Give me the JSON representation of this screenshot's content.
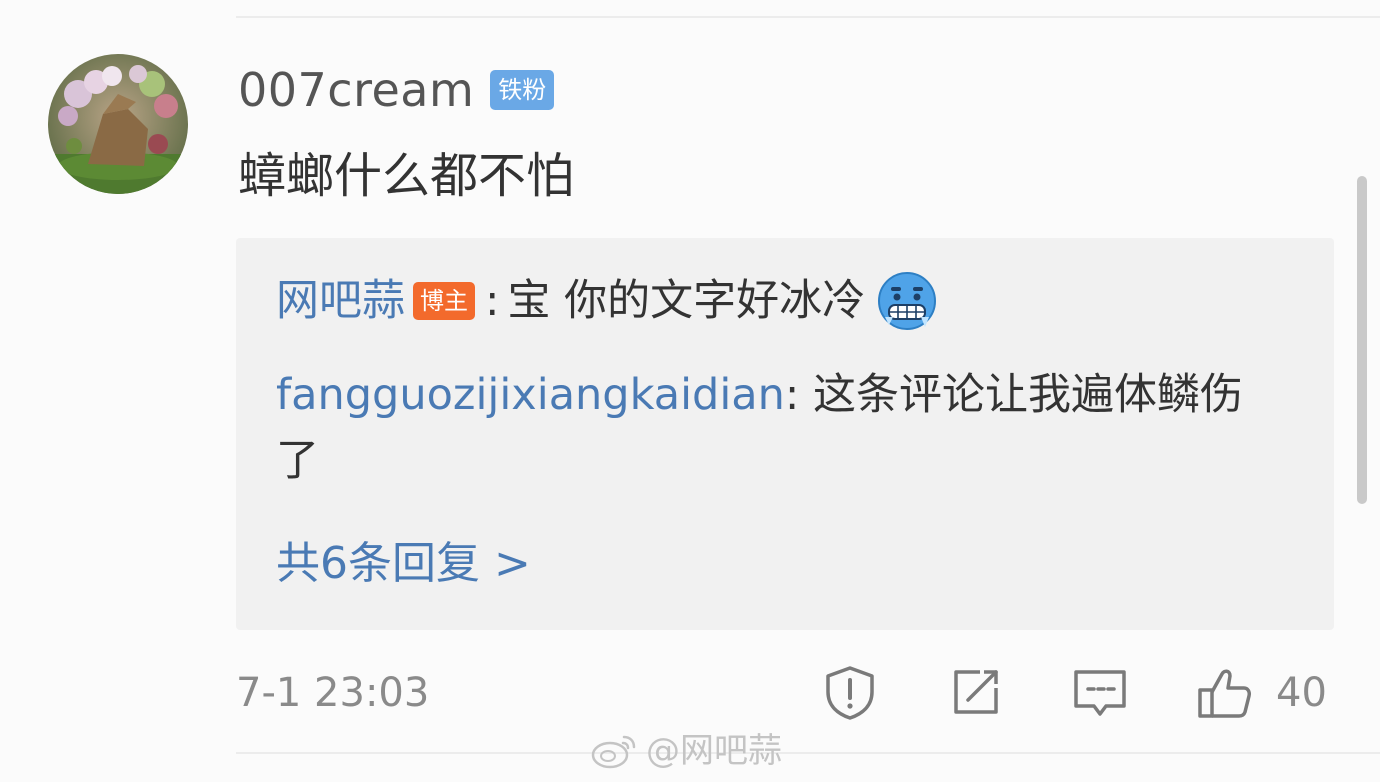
{
  "comment": {
    "username": "007cream",
    "fan_badge": "铁粉",
    "text": "蟑螂什么都不怕",
    "timestamp": "7-1 23:03",
    "like_count": "40"
  },
  "replies": [
    {
      "author": "网吧蒜",
      "badge": "博主",
      "separator": ":",
      "text": "宝 你的文字好冰冷",
      "emoji": "cold-face-emoji"
    },
    {
      "author": "fangguozijixiangkaidian",
      "separator": ": ",
      "text": "这条评论让我遍体鳞伤了"
    }
  ],
  "more_replies_label": "共6条回复 >",
  "watermark": "@网吧蒜",
  "icons": {
    "report": "report-shield-icon",
    "share": "share-icon",
    "comment": "comment-bubble-icon",
    "like": "thumbs-up-icon"
  },
  "colors": {
    "link_blue": "#4a7ab4",
    "fan_badge": "#6aa8e6",
    "blogger_badge": "#f36a2c",
    "reply_bg": "#f1f1f1"
  }
}
